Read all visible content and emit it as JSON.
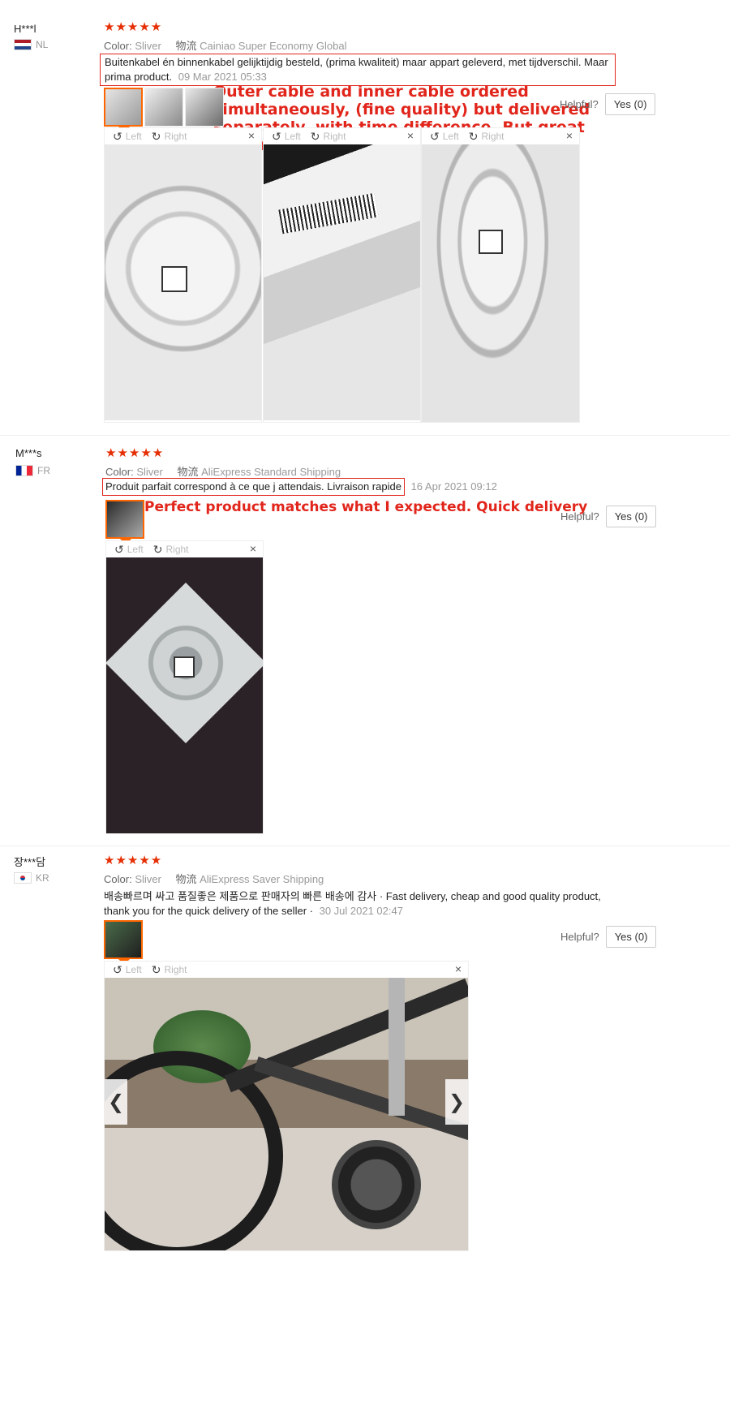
{
  "reviews": [
    {
      "user": "H***l",
      "country": "NL",
      "stars": "★★★★★",
      "color_label": "Color:",
      "color_value": "Sliver",
      "shipping_label": "物流",
      "shipping_value": "Cainiao Super Economy Global",
      "text": "Buitenkabel én binnenkabel gelijktijdig besteld, (prima kwaliteit) maar appart geleverd, met tijdverschil. Maar prima product.",
      "date": "09 Mar 2021 05:33",
      "annotation": "Outer cable and inner cable ordered simultaneously, (fine quality) but delivered separately, with time difference. But great product.",
      "helpful_label": "Helpful?",
      "yes_label": "Yes (0)"
    },
    {
      "user": "M***s",
      "country": "FR",
      "stars": "★★★★★",
      "color_label": "Color:",
      "color_value": "Sliver",
      "shipping_label": "物流",
      "shipping_value": "AliExpress Standard Shipping",
      "text": "Produit parfait correspond à ce que j attendais. Livraison rapide",
      "date": "16 Apr 2021 09:12",
      "annotation": "Perfect product matches what I expected. Quick delivery",
      "helpful_label": "Helpful?",
      "yes_label": "Yes (0)"
    },
    {
      "user": "장***담",
      "country": "KR",
      "stars": "★★★★★",
      "color_label": "Color:",
      "color_value": "Sliver",
      "shipping_label": "物流",
      "shipping_value": "AliExpress Saver Shipping",
      "text": "배송빠르며 싸고 품질좋은 제품으로 판매자의 빠른 배송에 감사 · Fast delivery, cheap and good quality product, thank you for the quick delivery of the seller ·",
      "date": "30 Jul 2021 02:47",
      "helpful_label": "Helpful?",
      "yes_label": "Yes (0)"
    }
  ],
  "viewer": {
    "left_label": "Left",
    "right_label": "Right",
    "rotate_left_icon": "↺",
    "rotate_right_icon": "↻",
    "close_icon": "×",
    "prev_icon": "❮",
    "next_icon": "❯"
  },
  "colors": {
    "accent": "#e62e04",
    "annotation": "#e1251b",
    "thumb_active": "#ff6600"
  }
}
